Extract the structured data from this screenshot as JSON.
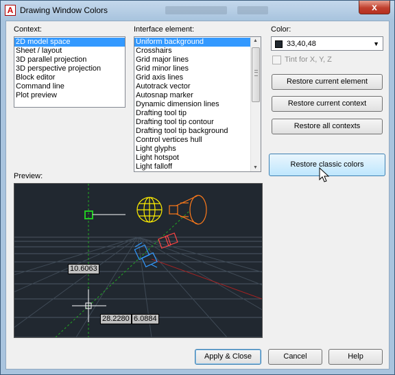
{
  "window": {
    "title": "Drawing Window Colors",
    "close_glyph": "x"
  },
  "context": {
    "label": "Context:",
    "items": [
      "2D model space",
      "Sheet / layout",
      "3D parallel projection",
      "3D perspective projection",
      "Block editor",
      "Command line",
      "Plot preview"
    ],
    "selected_index": 0
  },
  "interface": {
    "label": "Interface element:",
    "items": [
      "Uniform background",
      "Crosshairs",
      "Grid major lines",
      "Grid minor lines",
      "Grid axis lines",
      "Autotrack vector",
      "Autosnap marker",
      "Dynamic dimension lines",
      "Drafting tool tip",
      "Drafting tool tip contour",
      "Drafting tool tip background",
      "Control vertices hull",
      "Light glyphs",
      "Light hotspot",
      "Light falloff"
    ],
    "selected_index": 0
  },
  "color": {
    "label": "Color:",
    "value": "33,40,48",
    "swatch": "#21282f"
  },
  "tint": {
    "label": "Tint for X, Y, Z",
    "checked": false
  },
  "buttons": {
    "restore_element": "Restore current element",
    "restore_context": "Restore current context",
    "restore_all": "Restore all contexts",
    "restore_classic": "Restore classic colors",
    "apply_close": "Apply & Close",
    "cancel": "Cancel",
    "help": "Help"
  },
  "preview": {
    "label": "Preview:",
    "dim1": "10.6063",
    "dim2": "28.2280",
    "dim3": "6.0884",
    "background": "#212830"
  },
  "icons": [
    "autocad-app-icon",
    "close-icon",
    "dropdown-arrow-icon",
    "scroll-up-icon",
    "scroll-down-icon",
    "mouse-cursor-icon"
  ]
}
